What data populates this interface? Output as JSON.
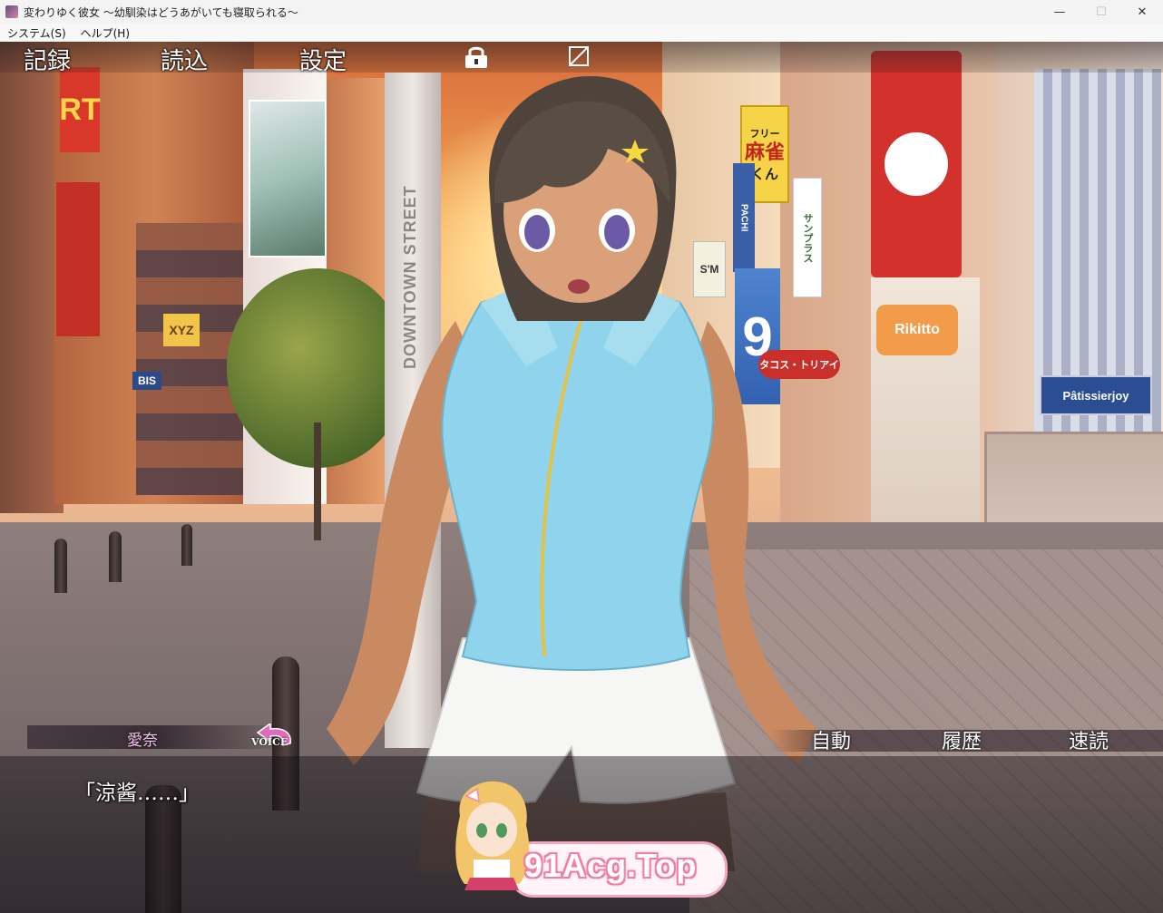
{
  "window": {
    "title": "変わりゆく彼女 ～幼馴染はどうあがいても寝取られる～",
    "controls": {
      "minimize": "—",
      "maximize": "☐",
      "close": "✕"
    }
  },
  "menubar": {
    "items": [
      "システム(S)",
      "ヘルプ(H)"
    ]
  },
  "scene": {
    "signs": {
      "rt": "RT",
      "mahjong_top": "フリー",
      "mahjong_mid": "麻雀",
      "mahjong_bottom": "くん",
      "downtown": "DOWNTOWN STREET",
      "xyz": "XYZ",
      "bis": "BIS",
      "sm": "S'M",
      "pachi": "PACHI",
      "sunplus": "サンプラス",
      "pastry": "Pâtissierjoy"
    }
  },
  "game_menu": {
    "save": "記録",
    "load": "読込",
    "config": "設定",
    "lock_icon": "lock-icon",
    "skip_icon": "close-box-icon"
  },
  "dialogue": {
    "speaker": "愛奈",
    "voice_label": "VOICE",
    "text": "「涼酱……」",
    "auto": "自動",
    "history": "履歴",
    "skip": "速読"
  },
  "watermark": {
    "text": "91Acg.Top"
  },
  "colors": {
    "accent_pink": "#f07fa3",
    "shirt": "#8fd3ec",
    "speaker_name": "#f3c4f0"
  }
}
